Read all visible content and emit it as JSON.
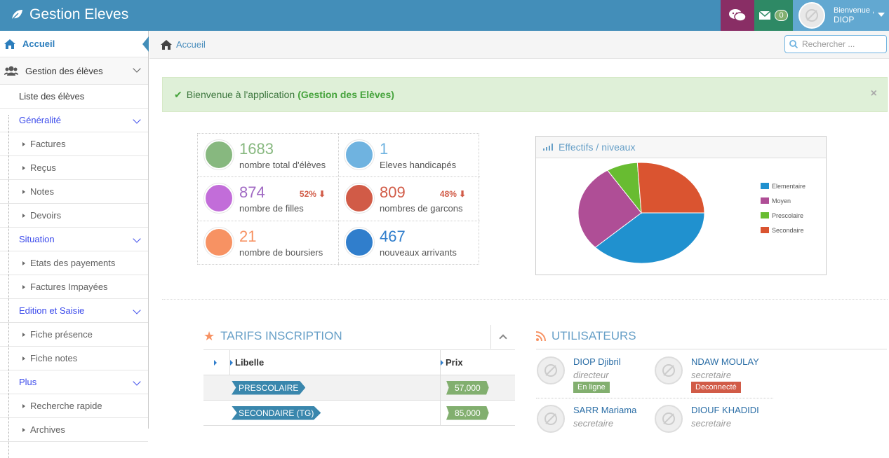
{
  "app": {
    "title": "Gestion Eleves"
  },
  "topnav": {
    "mail_count": "0",
    "greeting": "Bienvenue ,",
    "username": "DIOP"
  },
  "sidebar": {
    "home": "Accueil",
    "students_group": "Gestion des élèves",
    "items": {
      "liste": "Liste des élèves",
      "generalite": "Généralité",
      "factures": "Factures",
      "recus": "Reçus",
      "notes": "Notes",
      "devoirs": "Devoirs",
      "situation": "Situation",
      "etats": "Etats des payements",
      "impayees": "Factures Impayées",
      "edition": "Edition et Saisie",
      "presence": "Fiche présence",
      "fiche_notes": "Fiche notes",
      "plus": "Plus",
      "recherche": "Recherche rapide",
      "archives": "Archives"
    }
  },
  "breadcrumb": {
    "home": "Accueil"
  },
  "search": {
    "placeholder": "Rechercher ..."
  },
  "alert": {
    "text": "Bienvenue à l'application ",
    "highlight": "(Gestion des Elèves)",
    "close": "×"
  },
  "stats": [
    {
      "value": "1683",
      "label": "nombre total d'élèves",
      "color": "#87b87f"
    },
    {
      "value": "1",
      "label": "Eleves handicapés",
      "color": "#6fb3e0"
    },
    {
      "value": "874",
      "label": "nombre de filles",
      "pct": "52%",
      "color": "#c26dd9"
    },
    {
      "value": "809",
      "label": "nombres de garcons",
      "pct": "48%",
      "color": "#d15b47"
    },
    {
      "value": "21",
      "label": "nombre de boursiers",
      "color": "#f79263"
    },
    {
      "value": "467",
      "label": "nouveaux arrivants",
      "color": "#307ecc"
    }
  ],
  "chart_title": "Effectifs / niveaux",
  "chart_data": {
    "type": "pie",
    "categories": [
      "Elementaire",
      "Moyen",
      "Prescolaire",
      "Secondaire"
    ],
    "values": [
      38,
      28,
      8,
      26
    ],
    "colors": [
      "#2091cf",
      "#af4e96",
      "#68bc31",
      "#da5430"
    ],
    "legend": "right"
  },
  "tarifs": {
    "title": "TARIFS INSCRIPTION",
    "headers": [
      "Libelle",
      "Prix"
    ],
    "rows": [
      {
        "libelle": "PRESCOLAIRE",
        "prix": "57,000"
      },
      {
        "libelle": "SECONDAIRE (TG)",
        "prix": "85,000"
      }
    ]
  },
  "users": {
    "title": "UTILISATEURS",
    "list": [
      {
        "name": "DIOP Djibril",
        "role": "directeur",
        "status": "En ligne",
        "status_color": "#82af6f"
      },
      {
        "name": "NDAW MOULAY",
        "role": "secretaire",
        "status": "Deconnecté",
        "status_color": "#d15b47"
      },
      {
        "name": "SARR Mariama",
        "role": "secretaire"
      },
      {
        "name": "DIOUF KHADIDI",
        "role": "secretaire"
      }
    ]
  }
}
